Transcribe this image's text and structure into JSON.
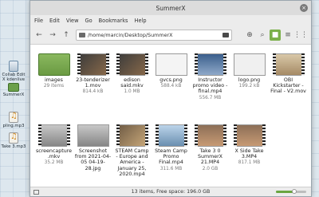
{
  "desktop": {
    "icons": [
      {
        "label": "Collab Edit X kdenlive",
        "icon": "kdenlive-file-icon"
      },
      {
        "label": "SummerX",
        "icon": "folder-icon"
      },
      {
        "label": "pling.mp3",
        "icon": "audio-file-icon"
      },
      {
        "label": "Take 3.mp3",
        "icon": "audio-file-icon"
      }
    ]
  },
  "window": {
    "title": "SummerX",
    "close_glyph": "×",
    "menu": [
      "File",
      "Edit",
      "View",
      "Go",
      "Bookmarks",
      "Help"
    ],
    "path": "/home/marcin/Desktop/SummerX",
    "toolbar_glyphs": {
      "back": "←",
      "forward": "→",
      "up": "↑",
      "bookmark": "⊕",
      "search": "⌕",
      "grid_view": "■",
      "list_view": "≡",
      "compact_view": "⋮⋮"
    }
  },
  "files": [
    {
      "name": "images",
      "size": "29 items",
      "kind": "folder",
      "tone": "folder"
    },
    {
      "name": "23-tenderizer 1.mov",
      "size": "814.4 kB",
      "kind": "video",
      "tone": "c-dark"
    },
    {
      "name": "edison said.mkv",
      "size": "1.0 MB",
      "kind": "video",
      "tone": "c-dark"
    },
    {
      "name": "gvcs.png",
      "size": "588.4 kB",
      "kind": "image",
      "tone": "c-white"
    },
    {
      "name": "Instructor promo video - final.mp4",
      "size": "556.7 MB",
      "kind": "video",
      "tone": "c-blue"
    },
    {
      "name": "logo.png",
      "size": "199.2 kB",
      "kind": "image",
      "tone": "c-logo"
    },
    {
      "name": "OBI Kickstarter - Final - V2.mov",
      "size": "",
      "kind": "video",
      "tone": "c-tan"
    },
    {
      "name": "screencapture.mkv",
      "size": "35.2 MB",
      "kind": "video",
      "tone": "c-grey"
    },
    {
      "name": "Screenshot from 2021-04-05 04-19-28.jpg",
      "size": "",
      "kind": "image",
      "tone": "c-grey"
    },
    {
      "name": "STEAM Camp - Europe and America - January 25, 2020.mp4",
      "size": "",
      "kind": "video",
      "tone": "c-room"
    },
    {
      "name": "Steam Camp Promo Final.mp4",
      "size": "311.6 MB",
      "kind": "video",
      "tone": "c-sky"
    },
    {
      "name": "Take 3 0 SummerX 21.MP4",
      "size": "2.0 GB",
      "kind": "video",
      "tone": "c-face"
    },
    {
      "name": "X Side Take 3.MP4",
      "size": "817.1 MB",
      "kind": "video",
      "tone": "c-face"
    }
  ],
  "status": {
    "text": "13 items, Free space: 196.0 GB",
    "zoom_level": 0.6
  },
  "colors": {
    "accent": "#7bb04a"
  }
}
